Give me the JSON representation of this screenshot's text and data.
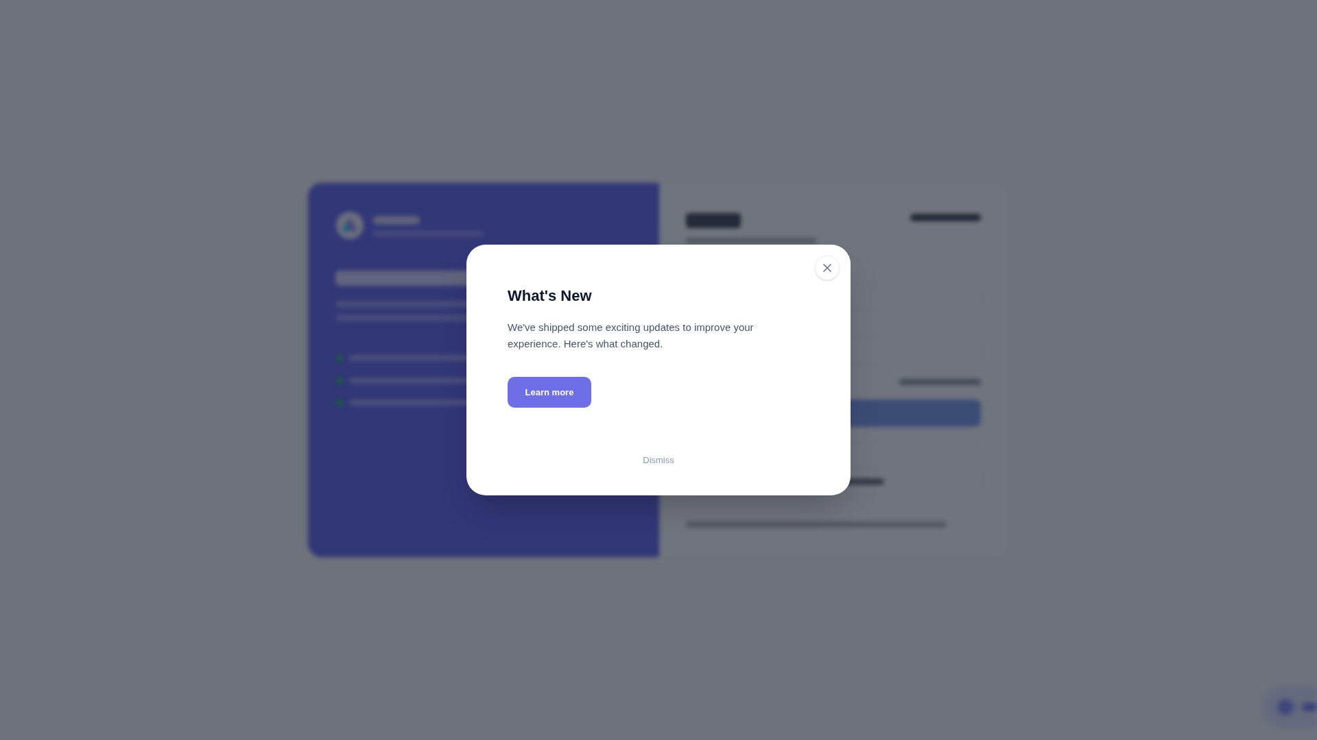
{
  "dialog": {
    "title": "What's New",
    "message": "We've shipped some exciting updates to improve your experience. Here's what changed.",
    "primary_button": "Learn more",
    "dismiss_link": "Dismiss"
  }
}
